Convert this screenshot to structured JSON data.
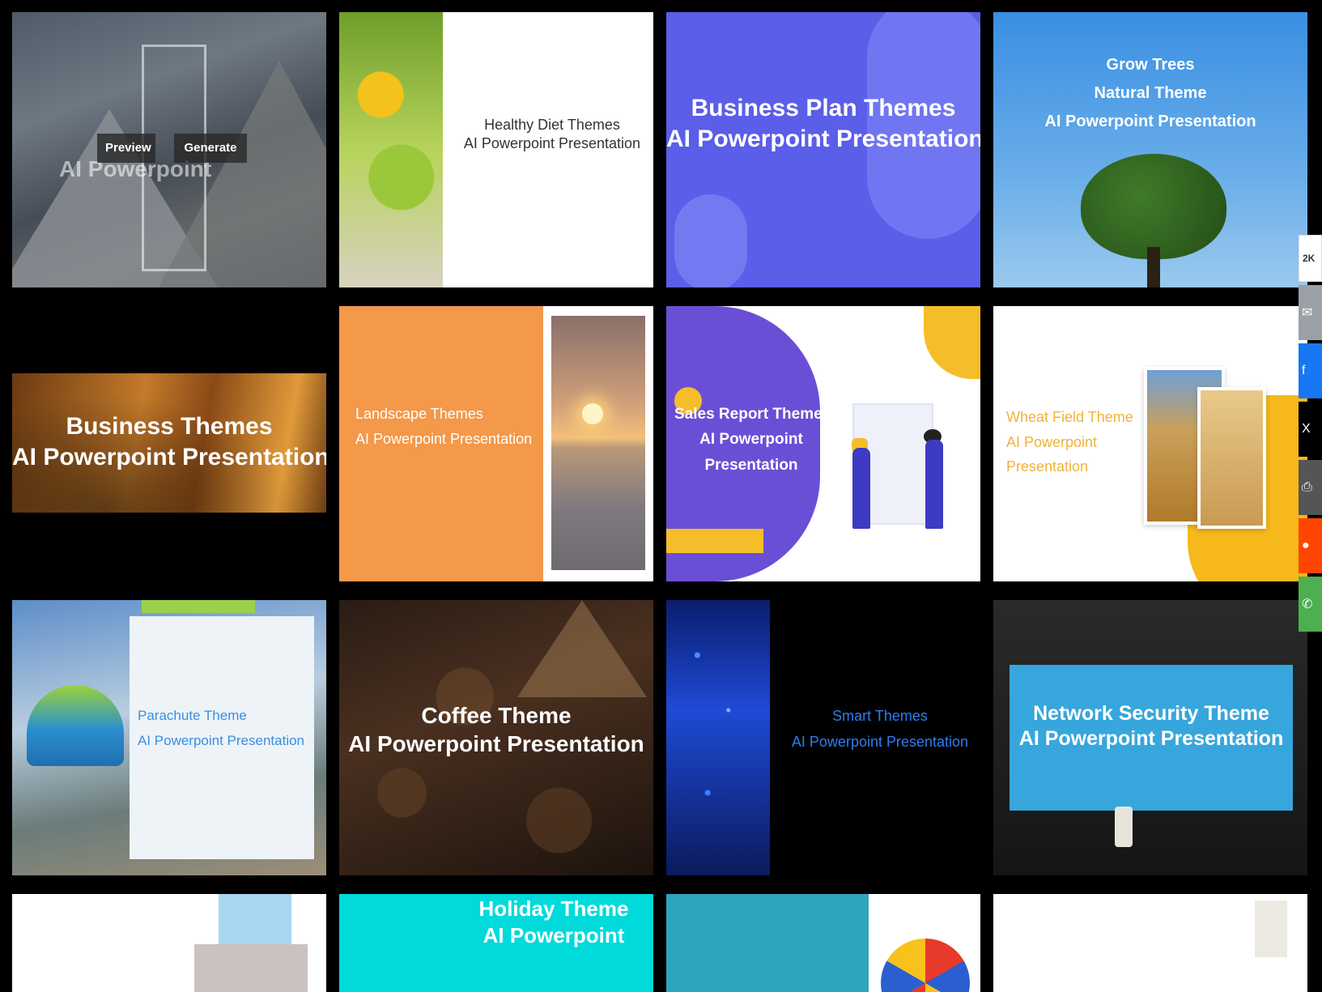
{
  "cards": [
    {
      "lines": [
        "Preview",
        "Generate"
      ],
      "watermark": "AI Powerpoint"
    },
    {
      "lines": [
        "Healthy Diet Themes",
        "AI Powerpoint Presentation"
      ]
    },
    {
      "lines": [
        "Business Plan Themes",
        "AI Powerpoint Presentation"
      ]
    },
    {
      "lines": [
        "Grow Trees",
        "Natural Theme",
        "AI Powerpoint Presentation"
      ]
    },
    {
      "lines": [
        "Business Themes",
        "AI Powerpoint Presentation"
      ]
    },
    {
      "lines": [
        "Landscape Themes",
        "AI Powerpoint Presentation"
      ]
    },
    {
      "lines": [
        "Sales Report Themes",
        "AI Powerpoint",
        "Presentation"
      ]
    },
    {
      "lines": [
        "Wheat Field Theme",
        "AI Powerpoint",
        "Presentation"
      ]
    },
    {
      "lines": [
        "Parachute Theme",
        "AI Powerpoint Presentation"
      ]
    },
    {
      "lines": [
        "Coffee Theme",
        "AI Powerpoint Presentation"
      ]
    },
    {
      "lines": [
        "Smart Themes",
        "AI Powerpoint Presentation"
      ]
    },
    {
      "lines": [
        "Network Security Theme",
        "AI Powerpoint Presentation"
      ]
    },
    {
      "lines": []
    },
    {
      "lines": [
        "Holiday Theme",
        "AI Powerpoint"
      ]
    },
    {
      "lines": []
    },
    {
      "lines": []
    }
  ],
  "share": {
    "count": "2K",
    "items": [
      "email-icon",
      "facebook-icon",
      "x-icon",
      "print-icon",
      "reddit-icon",
      "whatsapp-icon"
    ],
    "glyphs": [
      "✉",
      "f",
      "X",
      "⎙",
      "●",
      "✆"
    ]
  },
  "colors": {
    "background": "#000000",
    "business_plan": "#5a5ee8",
    "landscape": "#f4984a",
    "sales_report": "#6a4fd6",
    "network_security": "#37a6dd",
    "holiday": "#00dadb"
  }
}
